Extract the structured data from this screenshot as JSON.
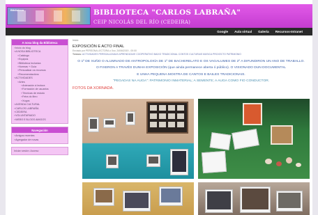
{
  "header": {
    "logo_text": "Biblioteca",
    "title": "BIBLIOTECA \"CARLOS LABRAÑA\"",
    "subtitle": "CEIP NICOLÁS DEL RÍO (CEDEIRA)"
  },
  "nav": {
    "items": [
      "Google",
      "Aula virtual",
      "Galería",
      "Recursos-Intranet"
    ]
  },
  "sidebar": {
    "box1_title": "A nosa blog da Biblioteca",
    "items": [
      {
        "label": "Inicio do blog",
        "level": 1
      },
      {
        "label": "A NOSA BIBLIOTECA",
        "level": 1
      },
      {
        "label": "Catálogo",
        "level": 2
      },
      {
        "label": "Equipos",
        "level": 2
      },
      {
        "label": "Biblioteca Inclusiva",
        "level": 2
      },
      {
        "label": "Normas + Guía",
        "level": 2
      },
      {
        "label": "Persoalizar os recursos",
        "level": 2
      },
      {
        "label": "Recomendacións",
        "level": 2
      },
      {
        "label": "ACTIVIDADES",
        "level": 1
      },
      {
        "label": "Artes",
        "level": 2
      },
      {
        "label": "Animación á lectura",
        "level": 3
      },
      {
        "label": "Formación de usuarios",
        "level": 3
      },
      {
        "label": "Técnicas de estudo",
        "level": 3
      },
      {
        "label": "Feira do libro",
        "level": 3
      },
      {
        "label": "Xogos",
        "level": 3
      },
      {
        "label": "AXENDA CULTURAL",
        "level": 1
      },
      {
        "label": "CARLOS LABRAÑA",
        "level": 1
      },
      {
        "label": "CEDEIRA",
        "level": 1
      },
      {
        "label": "VOLUNTARIADO",
        "level": 1
      },
      {
        "label": "WEBS E BLOGS AMIGOS",
        "level": 1
      }
    ],
    "box2_title": "Navegación",
    "box2_items": [
      "Amigos recentes",
      "Agregador de novas"
    ],
    "box3_text": "Iniciar sesión: Acceso"
  },
  "content": {
    "breadcrumb": "Inicio",
    "post_title": "EXPOSICIÓN E ACTO FINAL",
    "meta": "Enviado por PERSONA LECTORA o Xov, 24/06/2019 - 00:00",
    "tags_label": "Termos:",
    "tags": "ACTIVIDADES PERSOALIZADAS   APRENDIZAXE COOPERATIVO   BAIXO TRADICIONAL   CONTOS CULTURAIS   MÚSICA   PROXECTO PATRIMONIO",
    "lines": [
      "O 1º DE XUÑO O ALUMNADO DE ANTROPOLOXÍA DE 1º DE BACHERELATO E OS VAGALUMES DE 2º A DIFUNDIRON UN ANO DE TRABALLO.",
      "O FIXERON A TRAVÉS DUNHA EXPOSICIÓN (que ainda permanece aberta ó público). O VISIONADO DUN DOCUMENTAL",
      "E UNHA PEQUENA MOSTRA DE CANTOS E BAILES TRADICIONAIS.",
      "\"PEGADAS NA AUGA\": PATRIMONIO INMATERIAL; A SEMENTE; A AUGA COMO FIO CONDUCTOR."
    ],
    "photos_heading": "FOTOS DA XORNADA."
  },
  "colors": {
    "header": "#d24bdc",
    "navbar": "#2a2a2a",
    "sidebar_box": "#f4c6f4",
    "sidebar_title": "#c94fd2",
    "body_text": "#3a5fa8",
    "photos_heading": "#e0403c"
  }
}
